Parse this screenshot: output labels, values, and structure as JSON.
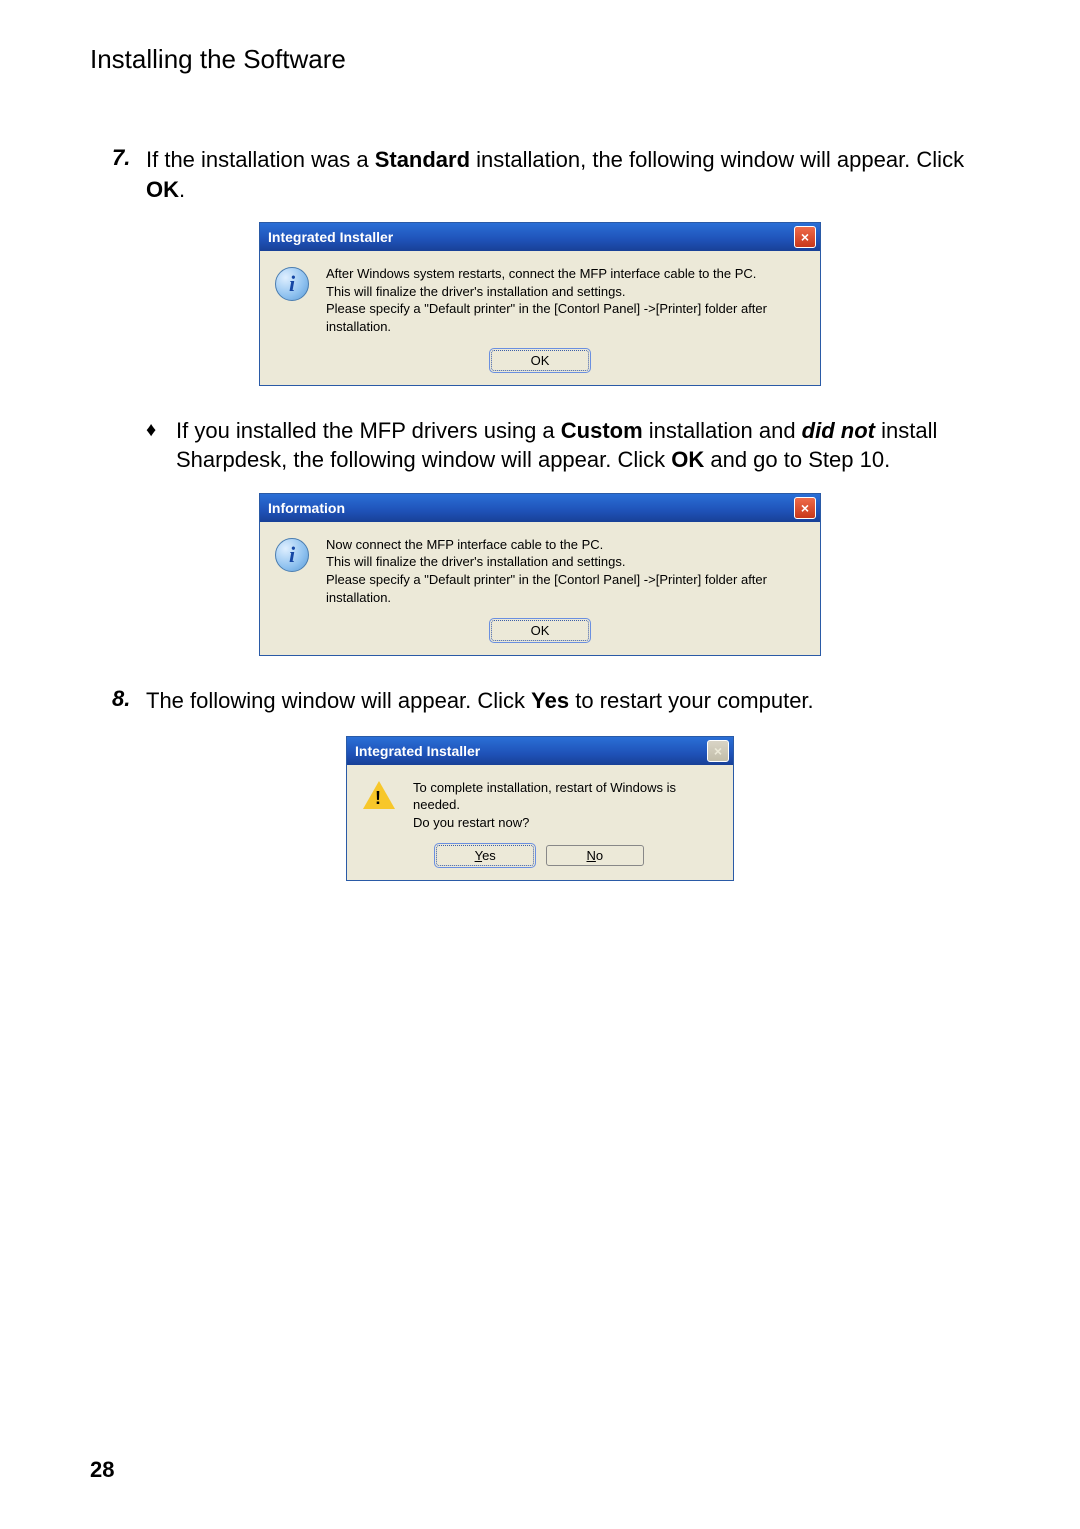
{
  "pageHeading": "Installing the Software",
  "step7": {
    "num": "7.",
    "text_a": "If the installation was a ",
    "text_b": "Standard",
    "text_c": " installation, the following window will appear. Click ",
    "text_d": "OK",
    "text_e": "."
  },
  "dialog1": {
    "title": "Integrated Installer",
    "line1": "After Windows system restarts, connect the MFP interface cable to the PC.",
    "line2": "This will finalize the driver's installation and settings.",
    "line3": "Please specify a \"Default printer\" in the [Contorl Panel] ->[Printer] folder after installation.",
    "ok": "OK"
  },
  "bullet": {
    "mark": "♦",
    "a": "If you installed the MFP drivers using a ",
    "b": "Custom",
    "c": " installation and ",
    "d": "did not",
    "e": " install Sharpdesk, the following window will appear. Click ",
    "f": "OK",
    "g": " and go to Step 10."
  },
  "dialog2": {
    "title": "Information",
    "line1": "Now connect the MFP interface cable to the PC.",
    "line2": "This will finalize the driver's installation and settings.",
    "line3": "Please specify a \"Default printer\" in the [Contorl Panel] ->[Printer] folder after installation.",
    "ok": "OK"
  },
  "step8": {
    "num": "8.",
    "text_a": "The following window will appear. Click ",
    "text_b": "Yes",
    "text_c": " to restart your computer."
  },
  "dialog3": {
    "title": "Integrated Installer",
    "line1": "To complete installation, restart of Windows is needed.",
    "line2": "Do you restart now?",
    "yes_u": "Y",
    "yes_rest": "es",
    "no_u": "N",
    "no_rest": "o"
  },
  "pageNumber": "28"
}
